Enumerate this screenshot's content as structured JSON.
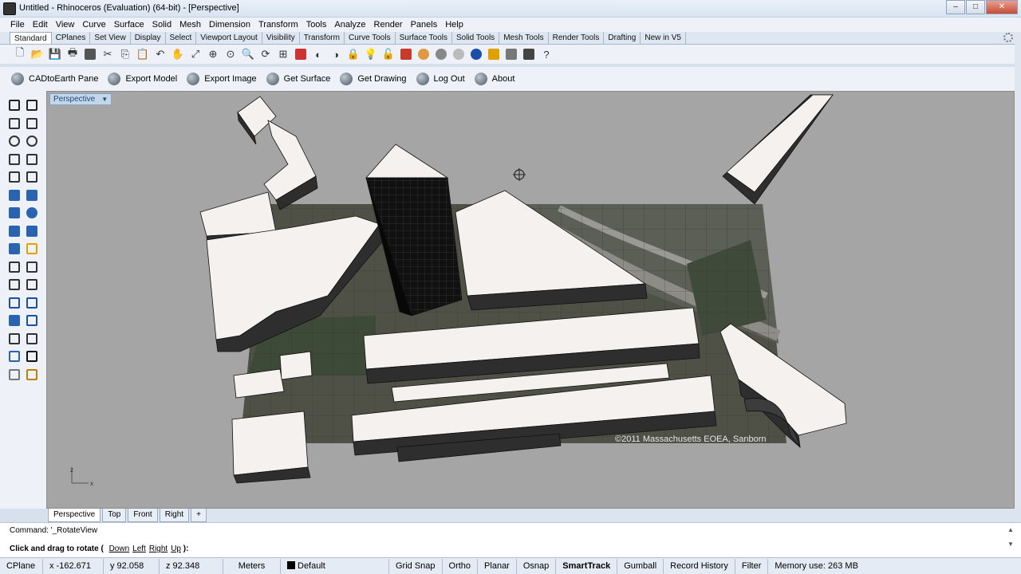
{
  "window": {
    "title": "Untitled - Rhinoceros (Evaluation) (64-bit) - [Perspective]"
  },
  "menu": [
    "File",
    "Edit",
    "View",
    "Curve",
    "Surface",
    "Solid",
    "Mesh",
    "Dimension",
    "Transform",
    "Tools",
    "Analyze",
    "Render",
    "Panels",
    "Help"
  ],
  "toolbar_tabs": [
    "Standard",
    "CPlanes",
    "Set View",
    "Display",
    "Select",
    "Viewport Layout",
    "Visibility",
    "Transform",
    "Curve Tools",
    "Surface Tools",
    "Solid Tools",
    "Mesh Tools",
    "Render Tools",
    "Drafting",
    "New in V5"
  ],
  "plugin_toolbar": [
    "CADtoEarth Pane",
    "Export Model",
    "Export Image",
    "Get Surface",
    "Get Drawing",
    "Log Out",
    "About"
  ],
  "viewport": {
    "title": "Perspective",
    "watermark": "©2011 Massachusetts EOEA, Sanborn",
    "axis_z": "z",
    "axis_x": "x"
  },
  "view_tabs": [
    "Perspective",
    "Top",
    "Front",
    "Right"
  ],
  "view_tab_add": "+",
  "command": {
    "history": "Command: '_RotateView",
    "prompt": "Click and drag to rotate (",
    "options": [
      "Down",
      "Left",
      "Right",
      "Up"
    ],
    "prompt_end": "):"
  },
  "status": {
    "cplane": "CPlane",
    "x": "x -162.671",
    "y": "y 92.058",
    "z": "z 92.348",
    "units": "Meters",
    "layer": "Default",
    "toggles": [
      "Grid Snap",
      "Ortho",
      "Planar",
      "Osnap",
      "SmartTrack",
      "Gumball",
      "Record History",
      "Filter"
    ],
    "memory": "Memory use: 263 MB"
  }
}
